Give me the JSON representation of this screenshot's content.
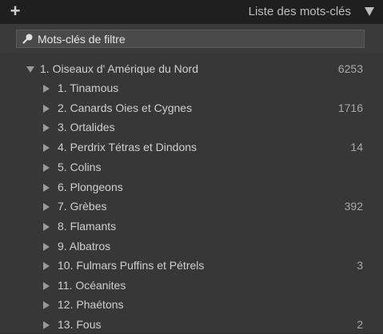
{
  "header": {
    "add_label": "+",
    "title": "Liste des mots-clés"
  },
  "search": {
    "placeholder": "Mots-clés de filtre",
    "value": ""
  },
  "root": {
    "label": "1. Oiseaux d' Amérique du Nord",
    "count": "6253"
  },
  "items": [
    {
      "label": "1. Tinamous",
      "count": ""
    },
    {
      "label": "2. Canards  Oies et Cygnes",
      "count": "1716"
    },
    {
      "label": "3. Ortalides",
      "count": ""
    },
    {
      "label": "4. Perdrix  Tétras et Dindons",
      "count": "14"
    },
    {
      "label": "5. Colins",
      "count": ""
    },
    {
      "label": "6. Plongeons",
      "count": ""
    },
    {
      "label": "7. Grèbes",
      "count": "392"
    },
    {
      "label": "8. Flamants",
      "count": ""
    },
    {
      "label": "9. Albatros",
      "count": ""
    },
    {
      "label": "10. Fulmars  Puffins et Pétrels",
      "count": "3"
    },
    {
      "label": "11. Océanites",
      "count": ""
    },
    {
      "label": "12. Phaétons",
      "count": ""
    },
    {
      "label": "13. Fous",
      "count": "2"
    }
  ]
}
